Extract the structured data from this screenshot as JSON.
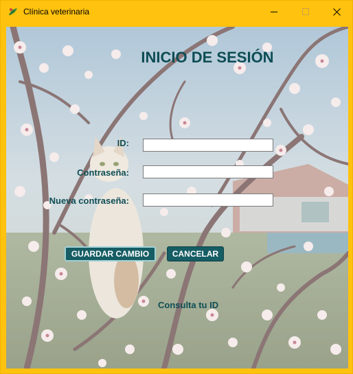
{
  "window": {
    "title": "Clínica veterinaria",
    "app_icon": "leaf-app-icon",
    "controls": {
      "minimize": "minimize-icon",
      "maximize": "maximize-icon",
      "close": "close-icon"
    },
    "accent_color": "#ffc20e"
  },
  "form": {
    "heading": "INICIO DE SESIÓN",
    "fields": {
      "id": {
        "label": "ID:",
        "value": ""
      },
      "password": {
        "label": "Contraseña:",
        "value": ""
      },
      "new_password": {
        "label": "Nueva contraseña:",
        "value": ""
      }
    },
    "buttons": {
      "save": "GUARDAR CAMBIO",
      "cancel": "CANCELAR"
    },
    "link": "Consulta tu ID",
    "text_color": "#0d4d55",
    "button_color": "#165d64"
  },
  "background": {
    "subject": "cat-in-blossoming-tree-image"
  }
}
